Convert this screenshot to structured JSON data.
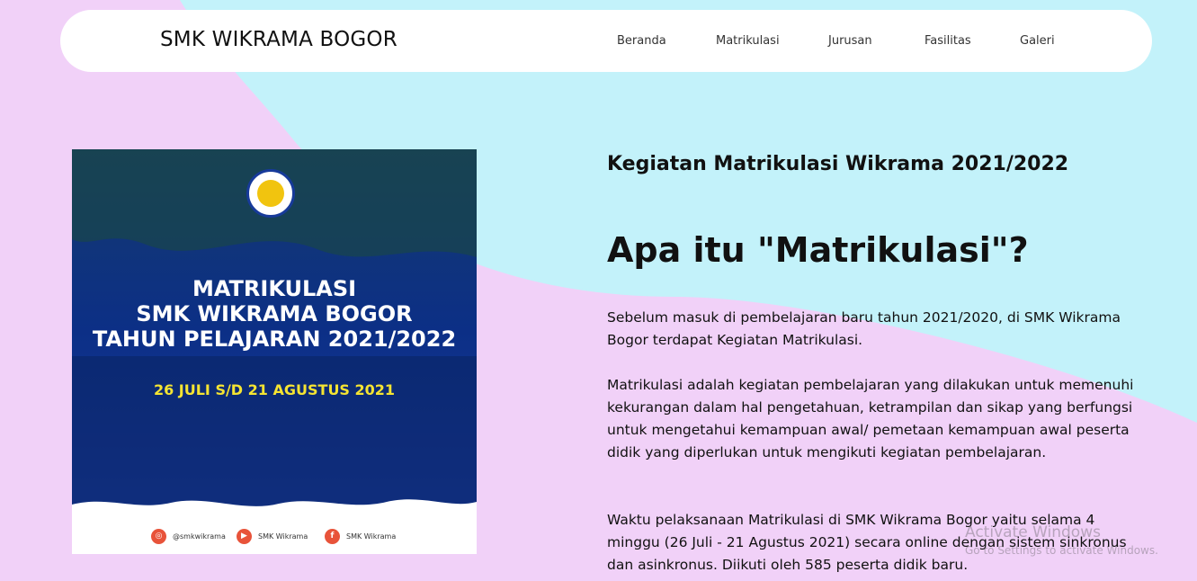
{
  "navbar": {
    "brand": "SMK WIKRAMA BOGOR",
    "links": [
      "Beranda",
      "Matrikulasi",
      "Jurusan",
      "Fasilitas",
      "Galeri"
    ]
  },
  "poster": {
    "title_lines": [
      "MATRIKULASI",
      "SMK WIKRAMA BOGOR",
      "TAHUN PELAJARAN 2021/2022"
    ],
    "date": "26 JULI S/D 21 AGUSTUS 2021",
    "socials": [
      {
        "icon": "instagram-icon",
        "label": "@smkwikrama"
      },
      {
        "icon": "youtube-icon",
        "label": "SMK Wikrama"
      },
      {
        "icon": "facebook-icon",
        "label": "SMK Wikrama"
      }
    ]
  },
  "content": {
    "subtitle": "Kegiatan Matrikulasi Wikrama 2021/2022",
    "heading": "Apa itu \"Matrikulasi\"?",
    "paragraphs": [
      "Sebelum masuk di pembelajaran baru tahun 2021/2020, di SMK Wikrama Bogor terdapat Kegiatan Matrikulasi.",
      "Matrikulasi adalah kegiatan pembelajaran yang dilakukan untuk memenuhi kekurangan dalam hal pengetahuan, ketrampilan dan sikap yang berfungsi untuk mengetahui kemampuan awal/ pemetaan kemampuan awal peserta didik yang diperlukan untuk mengikuti kegiatan pembelajaran.",
      "Waktu pelaksanaan Matrikulasi di SMK Wikrama Bogor yaitu selama 4 minggu (26 Juli - 21 Agustus 2021) secara online dengan sistem sinkronus dan asinkronus. Diikuti oleh 585 peserta didik baru."
    ]
  },
  "watermark": {
    "line1": "Activate Windows",
    "line2": "Go to Settings to activate Windows."
  },
  "colors": {
    "background_pink": "#f1d1f8",
    "background_cyan": "#c3f2fa",
    "poster_blue": "#0e2a7a",
    "date_yellow": "#f5e432",
    "social_red": "#e8533a"
  }
}
